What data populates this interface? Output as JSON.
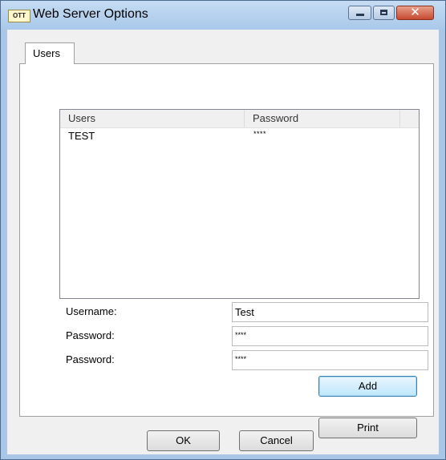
{
  "window": {
    "title": "Web Server Options",
    "app_icon_text": "OTT"
  },
  "tabs": [
    {
      "label": "Users",
      "active": true
    }
  ],
  "users_list": {
    "columns": [
      "Users",
      "Password"
    ],
    "rows": [
      {
        "user": "TEST",
        "password": "****"
      }
    ]
  },
  "form": {
    "username_label": "Username:",
    "username_value": "Test",
    "password_label": "Password:",
    "password_value": "****",
    "password_confirm_label": "Password:",
    "password_confirm_value": "****"
  },
  "buttons": {
    "add": "Add",
    "print": "Print",
    "ok": "OK",
    "cancel": "Cancel"
  },
  "icons": {
    "minimize": "minimize-icon",
    "maximize": "maximize-icon",
    "close": "close-icon",
    "close_glyph": "✕"
  },
  "colors": {
    "titlebar": "#aac6e6",
    "close_button": "#c74a31",
    "default_button": "#bee6fd"
  }
}
